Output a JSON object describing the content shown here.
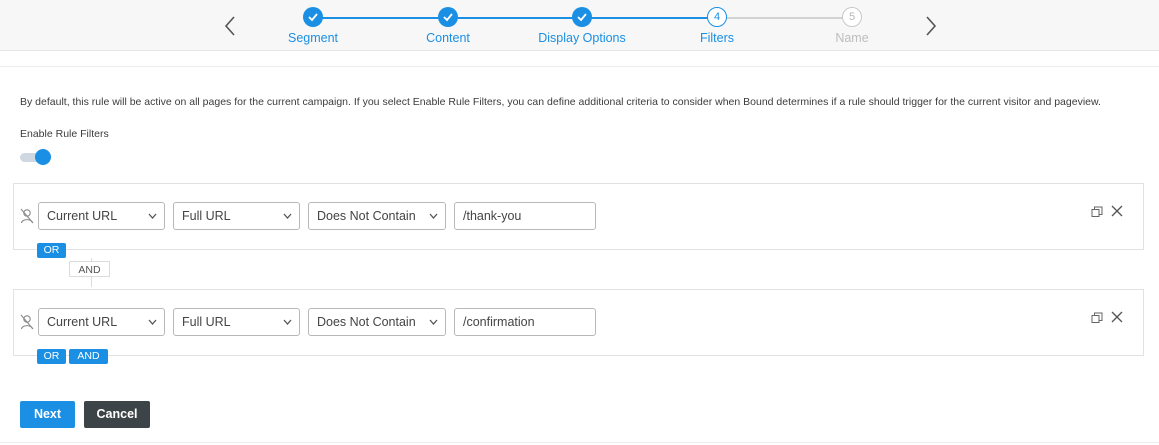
{
  "wizard": {
    "steps": [
      {
        "label": "Segment",
        "status": "complete"
      },
      {
        "label": "Content",
        "status": "complete"
      },
      {
        "label": "Display Options",
        "status": "complete"
      },
      {
        "label": "Filters",
        "status": "current",
        "number": "4"
      },
      {
        "label": "Name",
        "status": "upcoming",
        "number": "5"
      }
    ],
    "prev_icon": "chevron-left-icon",
    "next_icon": "chevron-right-icon"
  },
  "intro_text": "By default, this rule will be active on all pages for the current campaign. If you select Enable Rule Filters, you can define additional criteria to consider when Bound determines if a rule should trigger for the current visitor and pageview.",
  "toggle": {
    "label": "Enable Rule Filters",
    "enabled": true
  },
  "filters": [
    {
      "field": "Current URL",
      "scope": "Full URL",
      "operator": "Does Not Contain",
      "value": "/thank-you",
      "buttons": [
        "OR"
      ]
    },
    {
      "field": "Current URL",
      "scope": "Full URL",
      "operator": "Does Not Contain",
      "value": "/confirmation",
      "buttons": [
        "OR",
        "AND"
      ]
    }
  ],
  "connector_label": "AND",
  "actions": {
    "next_label": "Next",
    "cancel_label": "Cancel"
  },
  "colors": {
    "accent": "#1a8fe3",
    "cancel": "#3d4448",
    "inactive": "#bdbdbd"
  }
}
